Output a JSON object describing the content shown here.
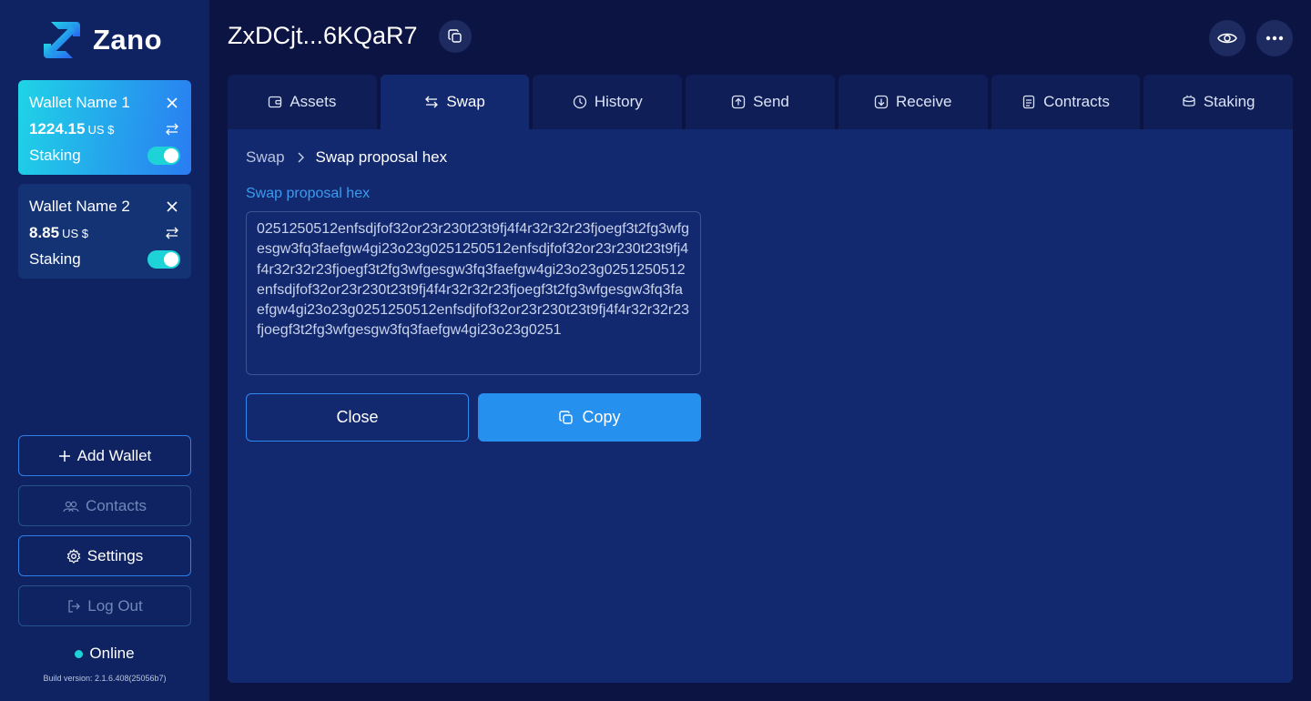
{
  "app": {
    "logo_text": "Zano"
  },
  "sidebar": {
    "wallets": [
      {
        "name": "Wallet Name 1",
        "balance": "1224.15",
        "currency": "US $",
        "staking_label": "Staking",
        "staking_enabled": true,
        "active": true
      },
      {
        "name": "Wallet Name 2",
        "balance": "8.85",
        "currency": "US $",
        "staking_label": "Staking",
        "staking_enabled": true,
        "active": false
      }
    ],
    "add_wallet_label": "Add Wallet",
    "contacts_label": "Contacts",
    "settings_label": "Settings",
    "logout_label": "Log Out",
    "status_label": "Online",
    "build_version": "Build version: 2.1.6.408(25056b7)"
  },
  "header": {
    "wallet_address": "ZxDCjt...6KQaR7"
  },
  "tabs": [
    {
      "label": "Assets",
      "icon": "wallet-icon",
      "active": false
    },
    {
      "label": "Swap",
      "icon": "swap-icon",
      "active": true
    },
    {
      "label": "History",
      "icon": "clock-icon",
      "active": false
    },
    {
      "label": "Send",
      "icon": "send-icon",
      "active": false
    },
    {
      "label": "Receive",
      "icon": "receive-icon",
      "active": false
    },
    {
      "label": "Contracts",
      "icon": "contract-icon",
      "active": false
    },
    {
      "label": "Staking",
      "icon": "staking-icon",
      "active": false
    }
  ],
  "main": {
    "breadcrumb": {
      "parent": "Swap",
      "current": "Swap proposal hex"
    },
    "field_label": "Swap proposal hex",
    "hex_value": "0251250512enfsdjfof32or23r230t23t9fj4f4r32r32r23fjoegf3t2fg3wfgesgw3fq3faefgw4gi23o23g0251250512enfsdjfof32or23r230t23t9fj4f4r32r32r23fjoegf3t2fg3wfgesgw3fq3faefgw4gi23o23g0251250512enfsdjfof32or23r230t23t9fj4f4r32r32r23fjoegf3t2fg3wfgesgw3fq3faefgw4gi23o23g0251250512enfsdjfof32or23r230t23t9fj4f4r32r32r23fjoegf3t2fg3wfgesgw3fq3faefgw4gi23o23g0251",
    "close_label": "Close",
    "copy_label": "Copy"
  },
  "colors": {
    "background": "#0c1444",
    "sidebar": "#0f2362",
    "panel": "#13296f",
    "accent": "#2590ee",
    "online": "#1ed3d8"
  }
}
